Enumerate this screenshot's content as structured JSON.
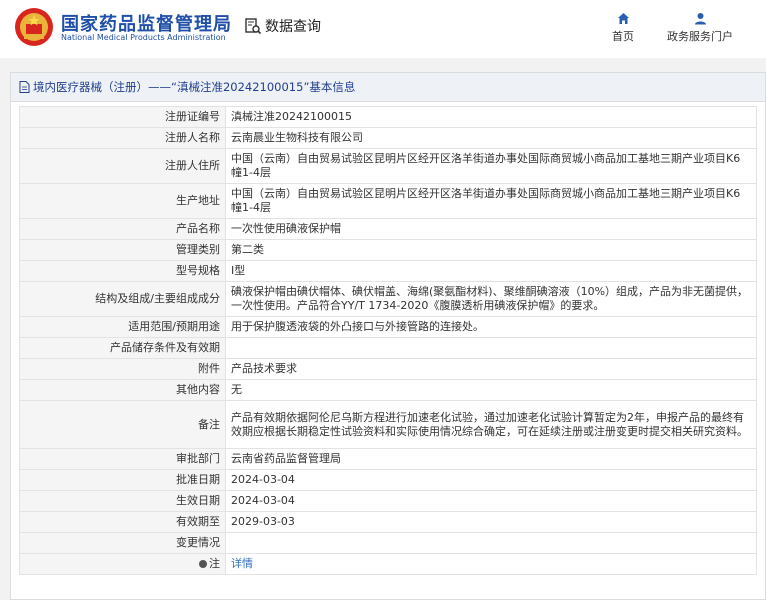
{
  "header": {
    "title_cn": "国家药品监督管理局",
    "title_en": "National Medical Products Administration",
    "data_query": "数据查询",
    "nav": {
      "home": "首页",
      "portal": "政务服务门户"
    }
  },
  "panel": {
    "title": "境内医疗器械（注册）——“滇械注准20242100015”基本信息"
  },
  "rows": [
    {
      "label": "注册证编号",
      "value": "滇械注准20242100015"
    },
    {
      "label": "注册人名称",
      "value": "云南晨业生物科技有限公司"
    },
    {
      "label": "注册人住所",
      "value": "中国（云南）自由贸易试验区昆明片区经开区洛羊街道办事处国际商贸城小商品加工基地三期产业项目K6幢1-4层"
    },
    {
      "label": "生产地址",
      "value": "中国（云南）自由贸易试验区昆明片区经开区洛羊街道办事处国际商贸城小商品加工基地三期产业项目K6幢1-4层"
    },
    {
      "label": "产品名称",
      "value": "一次性使用碘液保护帽"
    },
    {
      "label": "管理类别",
      "value": "第二类"
    },
    {
      "label": "型号规格",
      "value": "Ⅰ型"
    },
    {
      "label": "结构及组成/主要组成成分",
      "value": "碘液保护帽由碘伏帽体、碘伏帽盖、海绵(聚氨酯材料)、聚维酮碘溶液（10%）组成，产品为非无菌提供，一次性使用。产品符合YY/T 1734-2020《腹膜透析用碘液保护帽》的要求。"
    },
    {
      "label": "适用范围/预期用途",
      "value": "用于保护腹透液袋的外凸接口与外接管路的连接处。"
    },
    {
      "label": "产品储存条件及有效期",
      "value": ""
    },
    {
      "label": "附件",
      "value": "产品技术要求"
    },
    {
      "label": "其他内容",
      "value": "无"
    },
    {
      "label": "备注",
      "value": "产品有效期依据阿伦尼乌斯方程进行加速老化试验，通过加速老化试验计算暂定为2年，申报产品的最终有效期应根据长期稳定性试验资料和实际使用情况综合确定，可在延续注册或注册变更时提交相关研究资料。"
    },
    {
      "label": "审批部门",
      "value": "云南省药品监督管理局"
    },
    {
      "label": "批准日期",
      "value": "2024-03-04"
    },
    {
      "label": "生效日期",
      "value": "2024-03-04"
    },
    {
      "label": "有效期至",
      "value": "2029-03-03"
    },
    {
      "label": "变更情况",
      "value": ""
    }
  ],
  "note_row": {
    "label": "注",
    "link": "详情"
  }
}
